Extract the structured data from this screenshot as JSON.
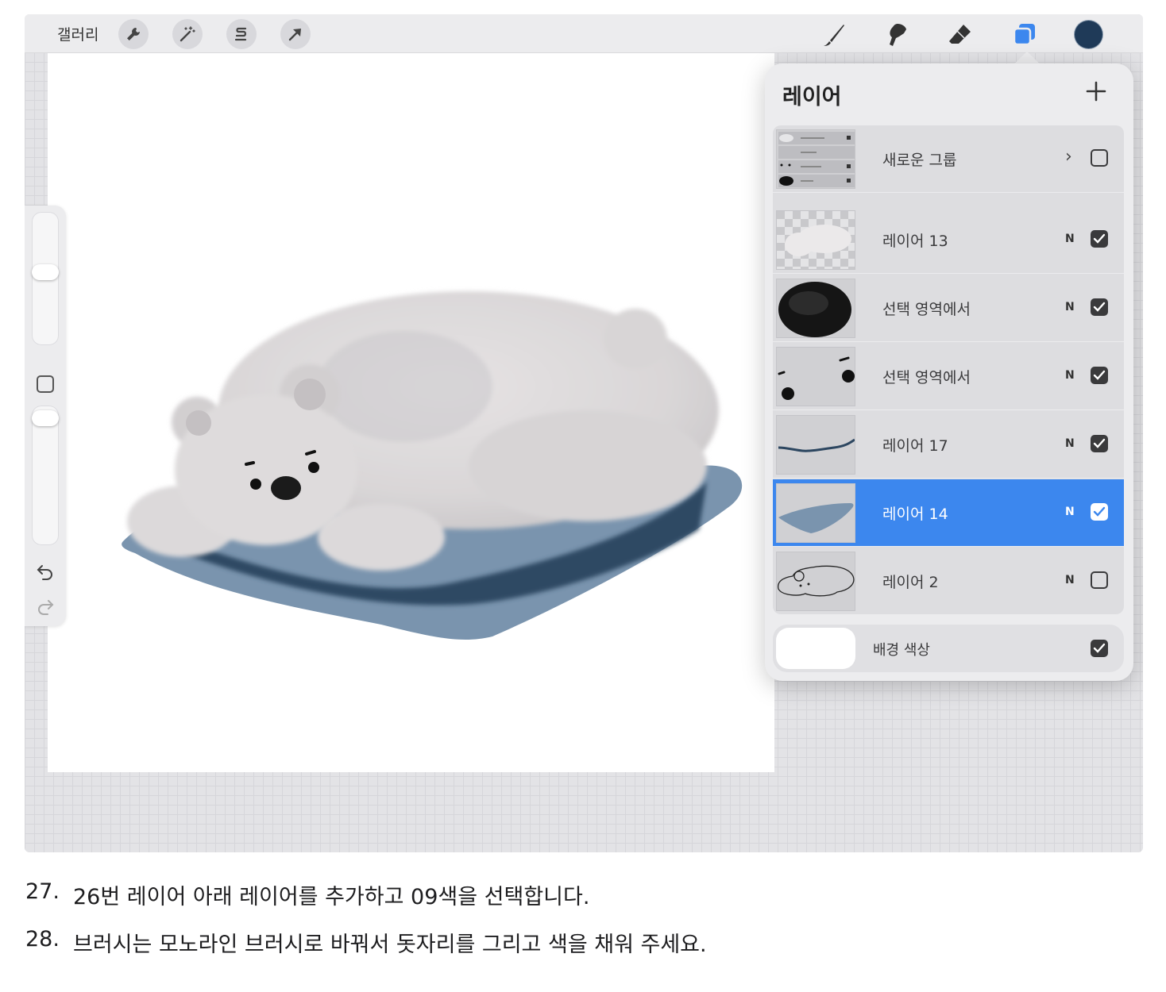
{
  "toolbar": {
    "gallery_label": "갤러리",
    "left_tools": [
      "wrench-icon",
      "magic-wand-icon",
      "selection-s-icon",
      "transform-arrow-icon"
    ],
    "right_tools": [
      "brush-icon",
      "smudge-icon",
      "eraser-icon",
      "layers-icon"
    ],
    "active_tool": "layers-icon",
    "current_color": "#1f3a58"
  },
  "layers_panel": {
    "title": "레이어",
    "add_icon": "plus-icon",
    "accent_color": "#3c87ee",
    "layers": [
      {
        "name": "새로운 그룹",
        "type": "group",
        "expand": "›",
        "visible": false
      },
      {
        "name": "레이어 13",
        "blend": "N",
        "visible": true
      },
      {
        "name": "선택 영역에서",
        "blend": "N",
        "visible": true
      },
      {
        "name": "선택 영역에서",
        "blend": "N",
        "visible": true
      },
      {
        "name": "레이어 17",
        "blend": "N",
        "visible": true
      },
      {
        "name": "레이어 14",
        "blend": "N",
        "visible": true,
        "selected": true
      },
      {
        "name": "레이어 2",
        "blend": "N",
        "visible": false
      }
    ],
    "background": {
      "name": "배경 색상",
      "visible": true,
      "color": "#ffffff"
    }
  },
  "instructions": [
    {
      "num": "27.",
      "text": "26번 레이어 아래 레이어를 추가하고 09색을 선택합니다."
    },
    {
      "num": "28.",
      "text": "브러시는 모노라인 브러시로 바꿔서 돗자리를 그리고 색을 채워 주세요."
    }
  ]
}
